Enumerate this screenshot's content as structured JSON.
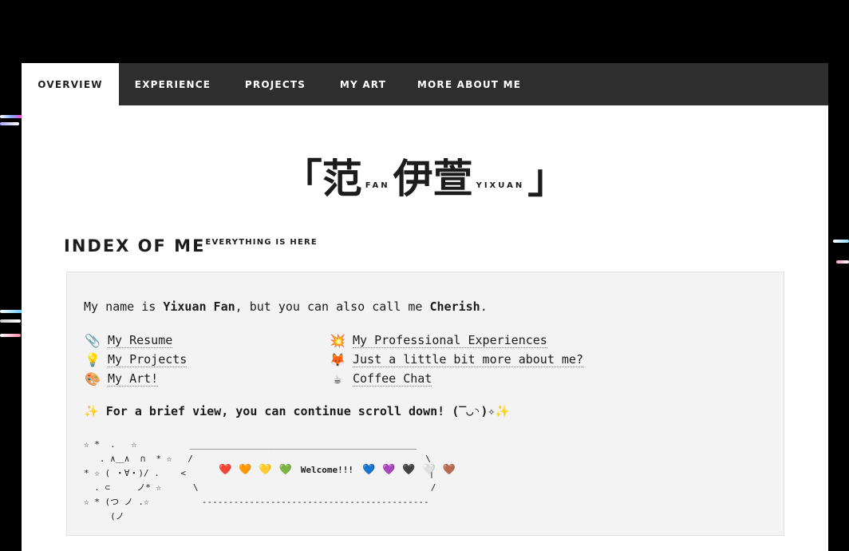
{
  "nav": {
    "tabs": [
      {
        "label": "OVERVIEW",
        "active": true
      },
      {
        "label": "EXPERIENCE",
        "active": false
      },
      {
        "label": "PROJECTS",
        "active": false
      },
      {
        "label": "MY ART",
        "active": false
      },
      {
        "label": "MORE ABOUT ME",
        "active": false
      }
    ]
  },
  "header": {
    "open_bracket": "「",
    "char1": "范",
    "small1": "FAN",
    "char2": "伊萱",
    "small2": "YIXUAN",
    "close_bracket": "」"
  },
  "section": {
    "title": "INDEX OF ME",
    "subtitle": "EVERYTHING IS HERE"
  },
  "intro": {
    "pre": "My name is ",
    "name": "Yixuan Fan",
    "mid": ", but you can also call me ",
    "nickname": "Cherish",
    "end": "."
  },
  "links": [
    {
      "emoji": "📎",
      "label": "My Resume"
    },
    {
      "emoji": "💡",
      "label": "My Projects"
    },
    {
      "emoji": "🎨",
      "label": "My Art!"
    },
    {
      "emoji": "💥",
      "label": "My Professional Experiences"
    },
    {
      "emoji": "🦊",
      "label": "Just a little bit more about me?"
    },
    {
      "emoji": "☕",
      "label": "Coffee Chat"
    }
  ],
  "brief": {
    "sparkle_left": "✨",
    "text": "For a brief view, you can continue scroll down! (‾◡◝)✧",
    "sparkle_right": "✨"
  },
  "ascii_art": "☆ *  .   ☆          ___________________________________________\n   . ∧＿∧  ∩  * ☆   /                                            \\\n* ☆ ( ・∀・)/ .    <                                              |\n  . ⊂     ノ* ☆      \\                                            /\n☆ * (つ ノ .☆          -------------------------------------------\n     (ノ",
  "hearts": {
    "left": [
      "❤️",
      "🧡",
      "💛",
      "💚"
    ],
    "welcome": "Welcome!!!",
    "right": [
      "💙",
      "💜",
      "🖤",
      "🤍",
      "🤎"
    ]
  }
}
